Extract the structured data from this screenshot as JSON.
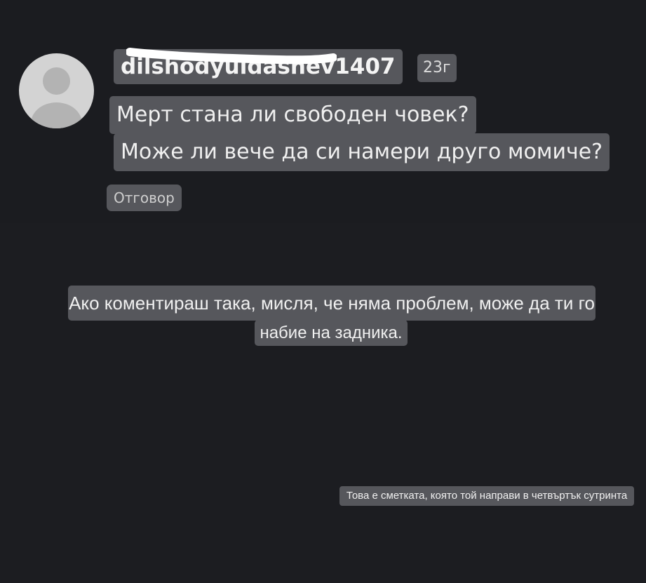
{
  "comment": {
    "username": "dilshodyuldashev1407",
    "time": "23г",
    "line1": "Мерт стана ли свободен човек?",
    "line2": "Може ли вече да си намери друго момиче?",
    "reply_label": "Отговор"
  },
  "captions": {
    "main_line1": "Ако коментираш така, мисля, че няма проблем, може да ти го",
    "main_line2": "набие на задника.",
    "note": "Това е сметката, която той направи в четвъртък сутринта"
  }
}
